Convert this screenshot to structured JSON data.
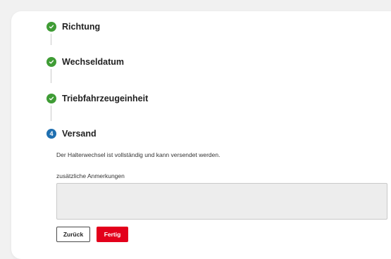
{
  "steps": [
    {
      "label": "Richtung",
      "status": "done",
      "icon": "check-icon"
    },
    {
      "label": "Wechseldatum",
      "status": "done",
      "icon": "check-icon"
    },
    {
      "label": "Triebfahrzeugeinheit",
      "status": "done",
      "icon": "check-icon"
    },
    {
      "label": "Versand",
      "status": "active",
      "number": "4"
    }
  ],
  "versand": {
    "info_text": "Der Halterwechsel ist vollständig und kann versendet werden.",
    "remarks_label": "zusätzliche Anmerkungen",
    "remarks_value": ""
  },
  "actions": {
    "back_label": "Zurück",
    "done_label": "Fertig"
  },
  "colors": {
    "done": "#3f9c35",
    "active": "#1f6fb0",
    "primary": "#e3001b"
  }
}
